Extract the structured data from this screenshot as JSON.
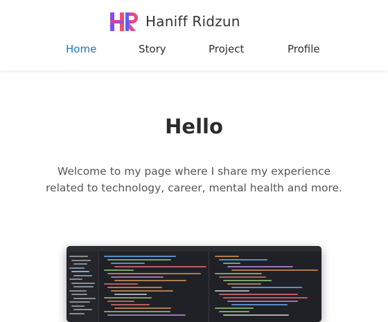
{
  "site": {
    "name": "Haniff Ridzun",
    "logo_icon": "hr-monogram-logo"
  },
  "nav": {
    "items": [
      {
        "label": "Home",
        "active": true
      },
      {
        "label": "Story",
        "active": false
      },
      {
        "label": "Project",
        "active": false
      },
      {
        "label": "Profile",
        "active": false
      }
    ]
  },
  "hero": {
    "heading": "Hello",
    "intro": "Welcome to my page where I share my experience related to technology, career, mental health and more."
  },
  "colors": {
    "accent": "#1a73c9",
    "logo_gradient_start": "#ff3b6b",
    "logo_gradient_end": "#6a5cff"
  }
}
